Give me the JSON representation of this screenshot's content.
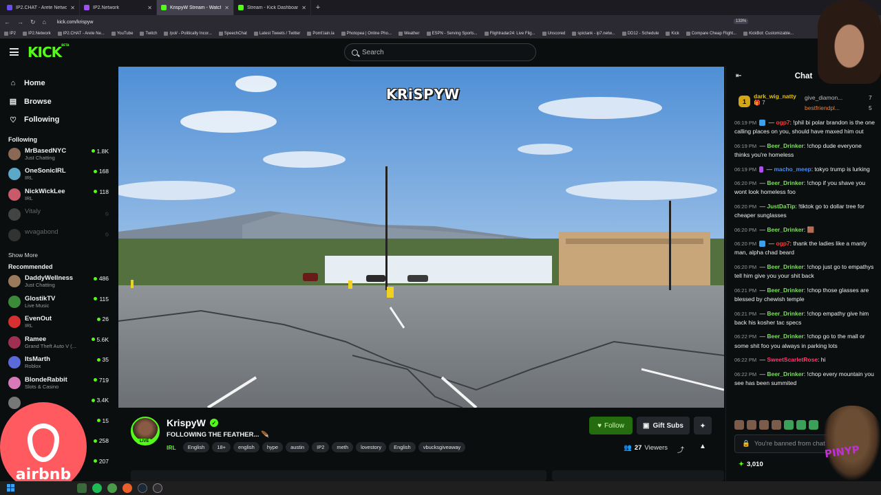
{
  "browser": {
    "tabs": [
      {
        "label": "IP2.CHAT - Arete Network",
        "color": "#6a4ff0",
        "active": false
      },
      {
        "label": "IP2.Network",
        "color": "#a04ff0",
        "active": false
      },
      {
        "label": "KrispyW Stream - Watch Li",
        "color": "#53fc18",
        "active": true
      },
      {
        "label": "Stream - Kick Dashboard",
        "color": "#53fc18",
        "active": false
      }
    ],
    "url": "kick.com/krispyw",
    "zoom": "133%",
    "bookmarks": [
      "IP2",
      "IP2.Network",
      "IP2.CHAT - Arete Ne...",
      "YouTube",
      "Twitch",
      "/pol/ - Politically Incor...",
      "SpeechChat",
      "Latest Tweets / Twitter",
      "Pomf.lain.la",
      "Photopea | Online Pho...",
      "Weather",
      "ESPN - Serving Sports...",
      "Flightradar24: Live Flig...",
      "Unscored",
      "spictank - ip7.netw...",
      "DD12 - Schedule",
      "Kick",
      "Compare Cheap Flight...",
      "KickBot: Customizable..."
    ]
  },
  "header": {
    "logo": "KICK",
    "logo_sup": "BETA",
    "search_placeholder": "Search"
  },
  "sidebar": {
    "nav": [
      {
        "label": "Home",
        "icon": "home-icon",
        "glyph": "⌂"
      },
      {
        "label": "Browse",
        "icon": "browse-icon",
        "glyph": "▤"
      },
      {
        "label": "Following",
        "icon": "heart-icon",
        "glyph": "♡"
      }
    ],
    "following_title": "Following",
    "following": [
      {
        "name": "MrBasedNYC",
        "category": "Just Chatting",
        "viewers": "1.8K",
        "color": "#8a6a55"
      },
      {
        "name": "OneSonicIRL",
        "category": "IRL",
        "viewers": "168",
        "color": "#5ba8c8"
      },
      {
        "name": "NickWickLee",
        "category": "IRL",
        "viewers": "118",
        "color": "#c85a6a"
      },
      {
        "name": "Vitaly",
        "category": "",
        "viewers": "",
        "color": "#aaaaaa",
        "offline": true
      },
      {
        "name": "wvagabond",
        "category": "",
        "viewers": "",
        "color": "#777777",
        "offline": true
      }
    ],
    "show_more": "Show More",
    "recommended_title": "Recommended",
    "recommended": [
      {
        "name": "DaddyWellness",
        "category": "Just Chatting",
        "viewers": "486",
        "color": "#9a7a5a"
      },
      {
        "name": "GlostikTV",
        "category": "Live Music",
        "viewers": "115",
        "color": "#3a8a3a"
      },
      {
        "name": "EvenOut",
        "category": "IRL",
        "viewers": "26",
        "color": "#d83030"
      },
      {
        "name": "Ramee",
        "category": "Grand Theft Auto V (...",
        "viewers": "5.6K",
        "color": "#a03050"
      },
      {
        "name": "ItsMarth",
        "category": "Roblox",
        "viewers": "35",
        "color": "#5a6ad8"
      },
      {
        "name": "BlondeRabbit",
        "category": "Slots & Casino",
        "viewers": "719",
        "color": "#d87ab8"
      },
      {
        "name": "",
        "category": "",
        "viewers": "3.4K",
        "color": "#777777"
      },
      {
        "name": "",
        "category": "",
        "viewers": "15",
        "color": "#777777"
      },
      {
        "name": "",
        "category": "",
        "viewers": "258",
        "color": "#777777"
      },
      {
        "name": "",
        "category": "",
        "viewers": "207",
        "color": "#777777"
      }
    ]
  },
  "video": {
    "watermark": "KRiSPYW"
  },
  "stream": {
    "name": "KrispyW",
    "title": "FOLLOWING THE FEATHER... 🪶",
    "live": "LIVE",
    "category": "IRL",
    "tags": [
      "English",
      "18+",
      "english",
      "hype",
      "austin",
      "IP2",
      "meth",
      "lovestory",
      "English",
      "vbucksgiveaway"
    ],
    "follow": "Follow",
    "gift": "Gift Subs",
    "viewers": "27",
    "viewers_label": "Viewers"
  },
  "chat": {
    "title": "Chat",
    "leaderboard": {
      "first": {
        "rank": "1",
        "name": "dark_wig_natty",
        "count": "7"
      },
      "others": [
        {
          "name": "give_diamon...",
          "count": "7"
        },
        {
          "name": "bestfriendpl...",
          "count": "5"
        }
      ]
    },
    "messages": [
      {
        "time": "06:19 PM",
        "user": "ogp7",
        "color": "#ff3b3b",
        "badge": "b",
        "text": "!phil bi polar brandon is the one calling places on you, should have maxed him out"
      },
      {
        "time": "06:19 PM",
        "user": "Beer_Drinker",
        "color": "#7be35a",
        "badge": "",
        "text": "!chop dude everyone thinks you're homeless"
      },
      {
        "time": "06:19 PM",
        "user": "macho_meep",
        "color": "#4a8cf0",
        "badge": "p",
        "text": "tokyo trump is lurking"
      },
      {
        "time": "06:20 PM",
        "user": "Beer_Drinker",
        "color": "#7be35a",
        "badge": "",
        "text": "!chop if you shave you wont look homeless foo"
      },
      {
        "time": "06:20 PM",
        "user": "JustDaTip",
        "color": "#7be35a",
        "badge": "",
        "text": "!tiktok go to dollar tree for cheaper sunglasses"
      },
      {
        "time": "06:20 PM",
        "user": "Beer_Drinker",
        "color": "#7be35a",
        "badge": "",
        "text": "🟫"
      },
      {
        "time": "06:20 PM",
        "user": "ogp7",
        "color": "#ff3b3b",
        "badge": "b",
        "text": "thank the ladies like a manly man, alpha chad beard"
      },
      {
        "time": "06:20 PM",
        "user": "Beer_Drinker",
        "color": "#7be35a",
        "badge": "",
        "text": "!chop just go to empathys tell him give you your shit back"
      },
      {
        "time": "06:21 PM",
        "user": "Beer_Drinker",
        "color": "#7be35a",
        "badge": "",
        "text": "!chop those glasses are blessed by chewish temple"
      },
      {
        "time": "06:21 PM",
        "user": "Beer_Drinker",
        "color": "#7be35a",
        "badge": "",
        "text": "!chop empathy give him back his kosher tac specs"
      },
      {
        "time": "06:22 PM",
        "user": "Beer_Drinker",
        "color": "#7be35a",
        "badge": "",
        "text": "!chop go to the mall or some shit foo you always in parking lots"
      },
      {
        "time": "06:22 PM",
        "user": "SweetScarletRose",
        "color": "#ff3b6b",
        "badge": "",
        "text": "hi"
      },
      {
        "time": "06:22 PM",
        "user": "Beer_Drinker",
        "color": "#7be35a",
        "badge": "",
        "text": "!chop every mountain you see has been summited"
      }
    ],
    "input_placeholder": "You're banned from chat",
    "points": "3,010"
  },
  "overlays": {
    "airbnb": "airbnb",
    "chewie_text": "PINYP"
  }
}
